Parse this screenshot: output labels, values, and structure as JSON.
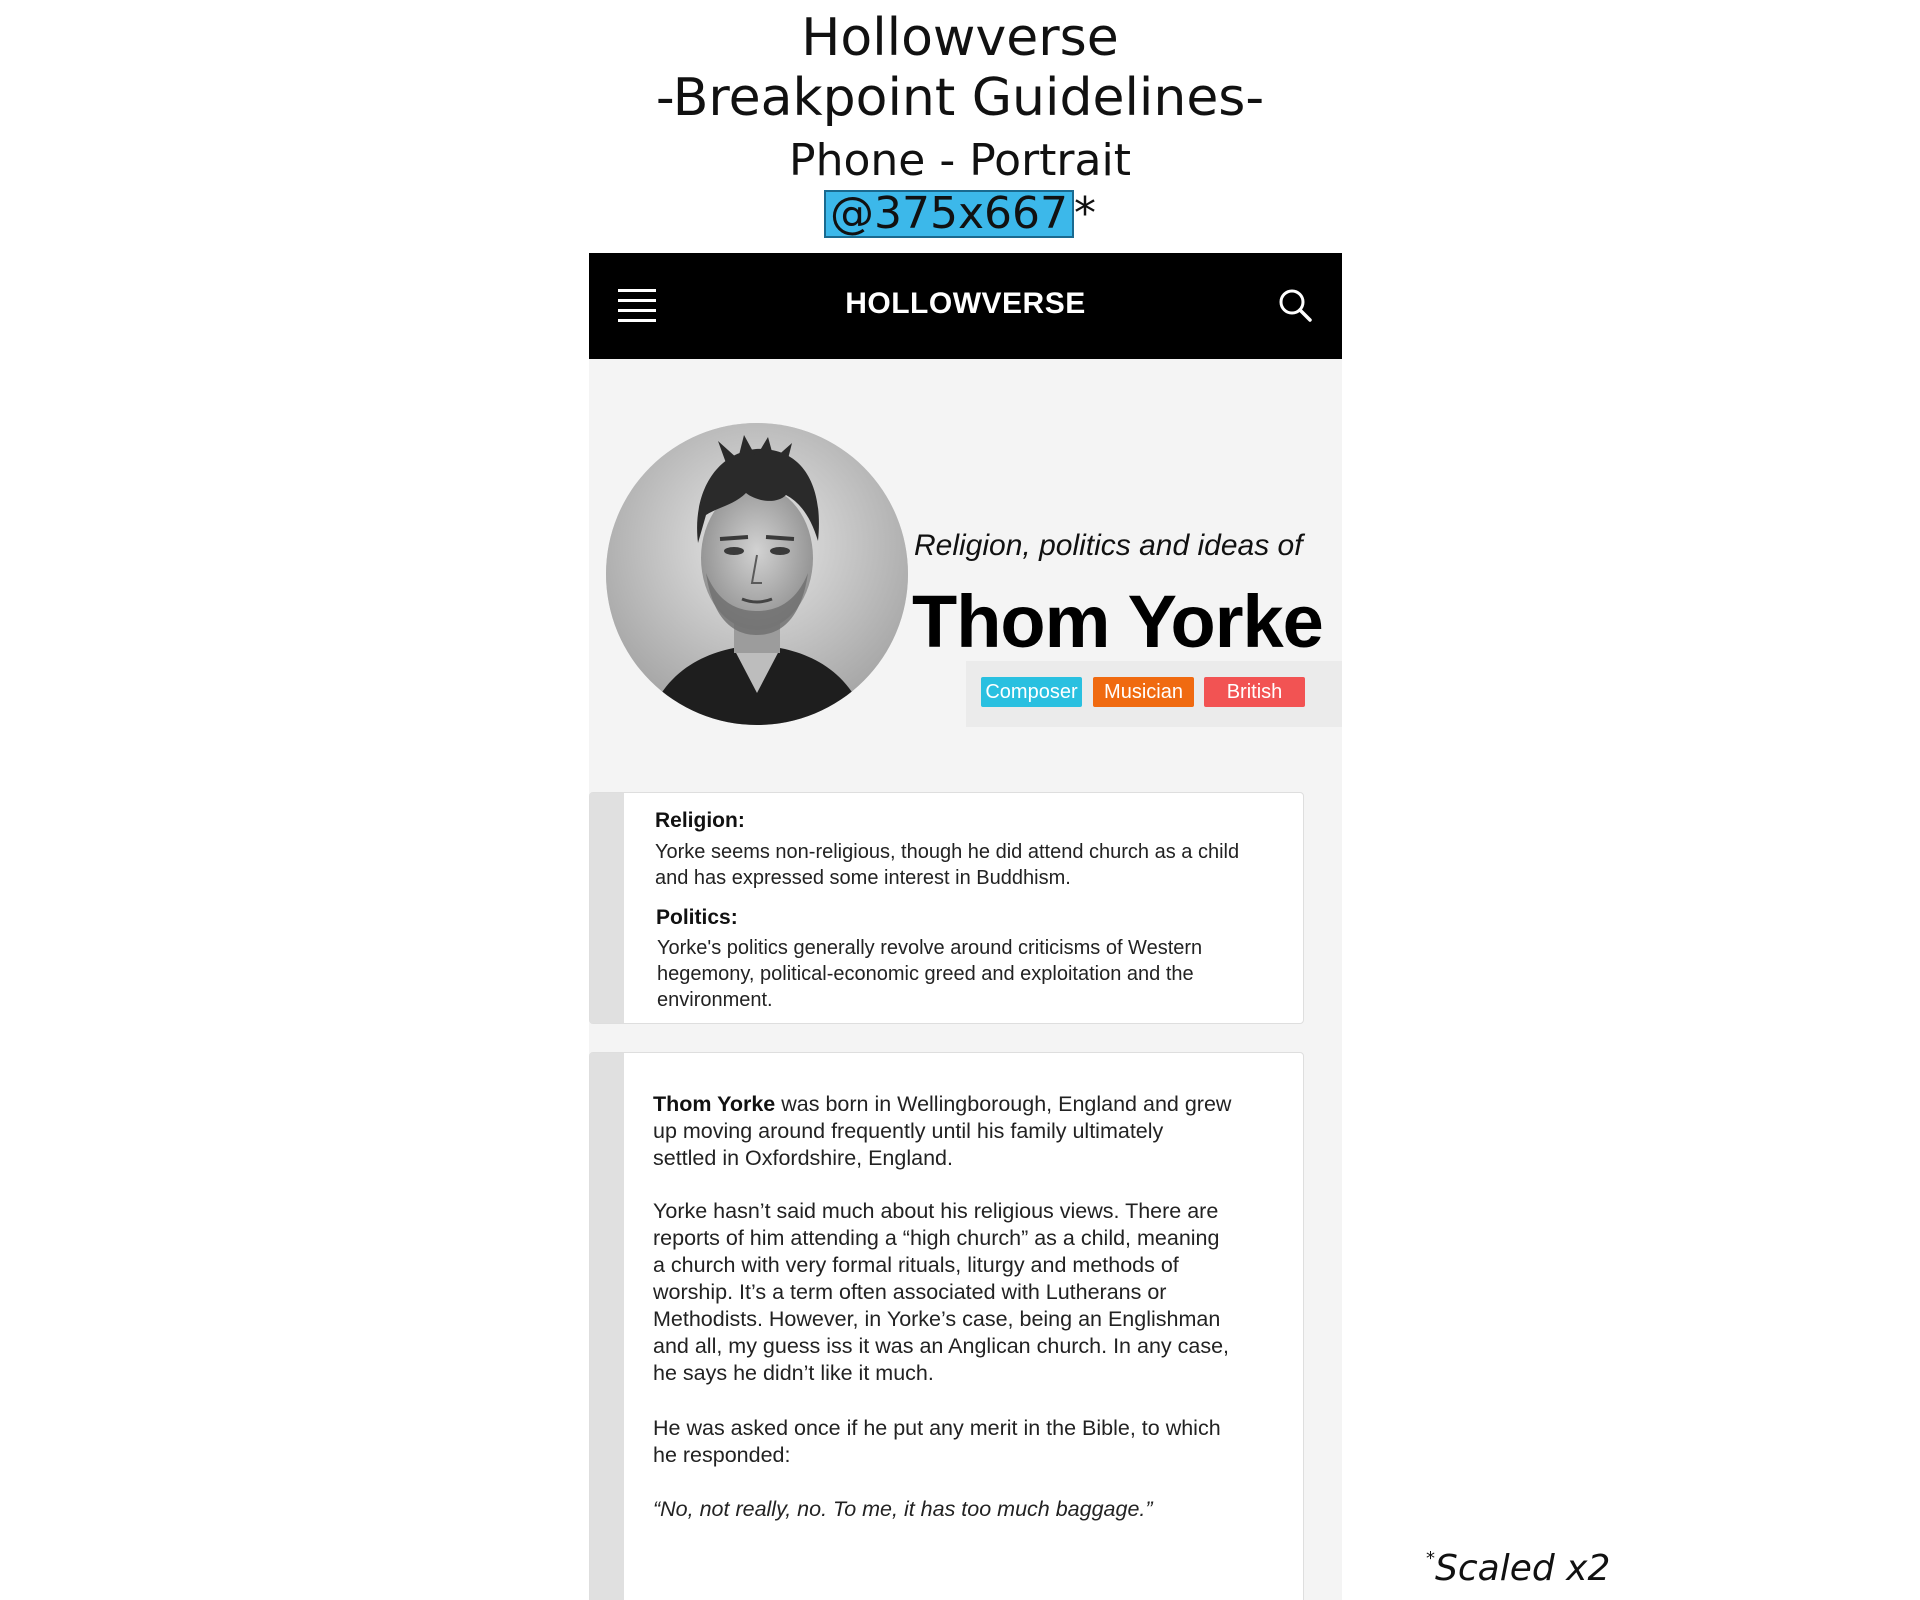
{
  "guide": {
    "title": "Hollowverse",
    "subtitle": "-Breakpoint Guidelines-",
    "device": "Phone - Portrait",
    "resolution": "@375x667",
    "asterisk": "*",
    "scaled_star": "*",
    "scaled_note": "Scaled x2",
    "highlight_color": "#3cb8ea"
  },
  "navbar": {
    "brand": "HOLLOWVERSE",
    "menu_icon": "hamburger-menu-icon",
    "search_icon": "search-icon",
    "background": "#000000"
  },
  "profile": {
    "subtitle": "Religion, politics and ideas of",
    "name": "Thom Yorke",
    "avatar_icon": "portrait-photo",
    "tags": [
      {
        "label": "Composer",
        "color": "#29c0e0"
      },
      {
        "label": "Musician",
        "color": "#f06a10"
      },
      {
        "label": "British",
        "color": "#f25353"
      }
    ]
  },
  "summary": {
    "religion_label": "Religion:",
    "religion_lines": [
      "Yorke seems non-religious, though he did attend church as a child",
      "and has expressed some interest in Buddhism."
    ],
    "politics_label": "Politics:",
    "politics_lines": [
      "Yorke's politics generally revolve around criticisms of Western",
      "hegemony, political-economic greed and exploitation and the",
      "environment."
    ]
  },
  "article": {
    "p1_name": "Thom Yorke",
    "p1_rest_lines": [
      " was born in Wellingborough, England and grew",
      "up moving around frequently until his family ultimately",
      "settled in Oxfordshire, England."
    ],
    "p2_lines": [
      "Yorke hasn’t said much about his religious views. There are",
      "reports of him attending a “high church” as a child, meaning",
      "a church with very formal rituals, liturgy and methods of",
      "worship. It’s a term often associated with Lutherans or",
      "Methodists. However, in Yorke’s case, being an Englishman",
      "and all, my guess iss it was an Anglican church. In any case,",
      "he says he didn’t like it much."
    ],
    "p3_lines": [
      "He was asked once if he put any merit in the Bible, to which",
      "he responded:"
    ],
    "quote": "“No, not really, no. To me, it has too much baggage.”"
  }
}
